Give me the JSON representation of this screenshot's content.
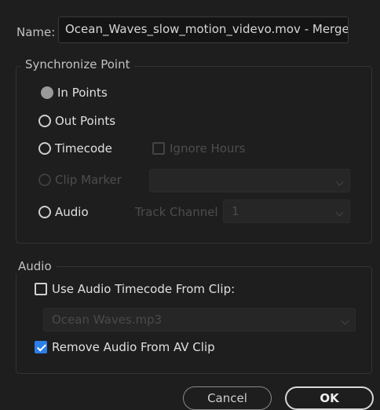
{
  "name": {
    "label": "Name:",
    "value": "Ocean_Waves_slow_motion_videvo.mov - Merged"
  },
  "sync": {
    "title": "Synchronize Point",
    "in_points": "In Points",
    "out_points": "Out Points",
    "timecode": "Timecode",
    "ignore_hours": "Ignore Hours",
    "clip_marker": "Clip Marker",
    "clip_marker_value": "",
    "audio": "Audio",
    "track_channel_label": "Track Channel",
    "track_channel_value": "1",
    "selected": "in_points"
  },
  "audio": {
    "title": "Audio",
    "use_timecode_label": "Use Audio Timecode From Clip:",
    "use_timecode_checked": false,
    "clip_select_value": "Ocean Waves.mp3",
    "remove_audio_label": "Remove Audio From AV Clip",
    "remove_audio_checked": true
  },
  "buttons": {
    "cancel": "Cancel",
    "ok": "OK"
  },
  "colors": {
    "background": "#1e1e1e",
    "checkbox_accent": "#2c7fe6"
  }
}
